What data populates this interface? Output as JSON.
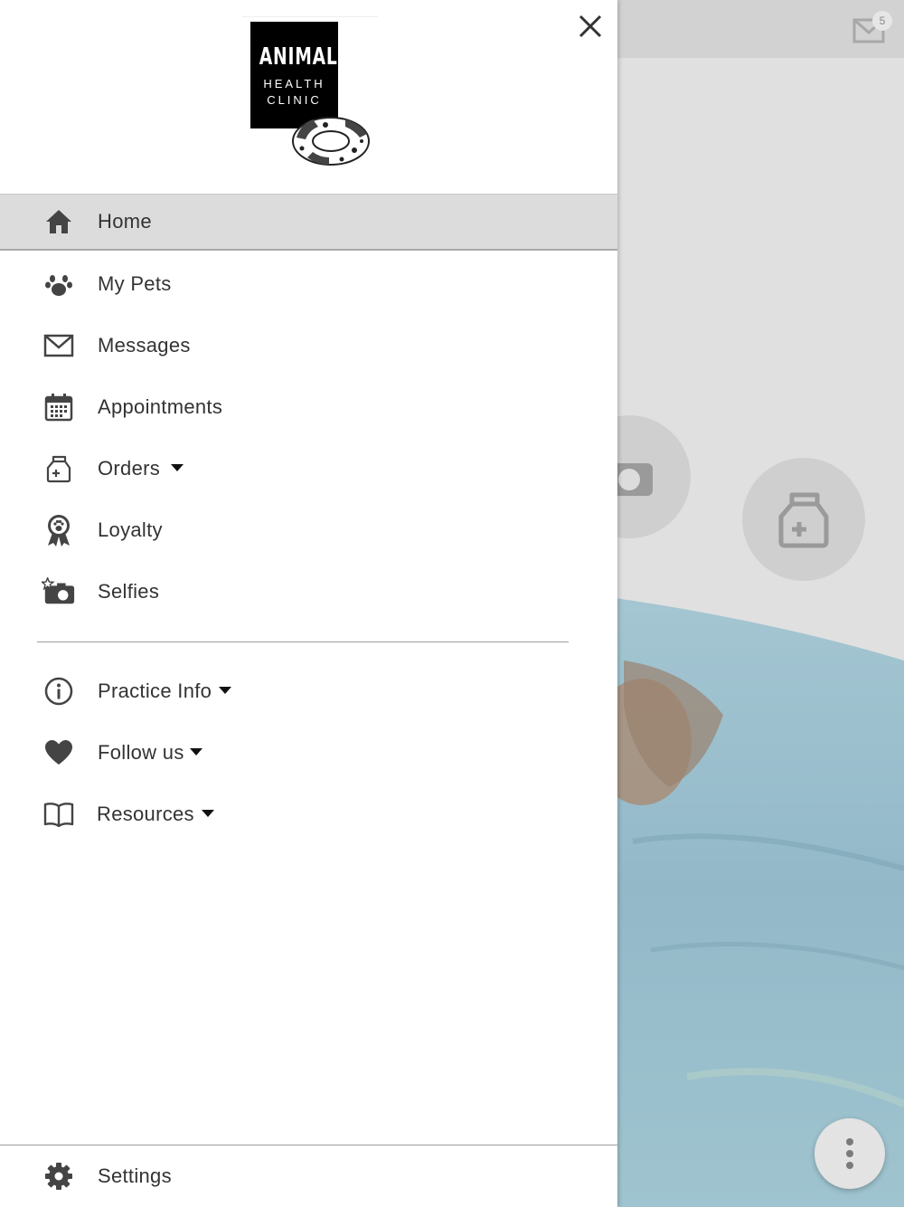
{
  "drawer": {
    "logo": {
      "line1": "ANIMAL",
      "line2": "HEALTH",
      "line3": "CLINIC"
    },
    "menu": [
      {
        "label": "Home",
        "icon": "home-icon",
        "active": true
      },
      {
        "label": "My Pets",
        "icon": "paw-icon"
      },
      {
        "label": "Messages",
        "icon": "envelope-icon"
      },
      {
        "label": "Appointments",
        "icon": "calendar-icon"
      },
      {
        "label": "Orders",
        "icon": "medicine-bag-icon",
        "has_dropdown": true
      },
      {
        "label": "Loyalty",
        "icon": "award-ribbon-icon"
      },
      {
        "label": "Selfies",
        "icon": "camera-star-icon"
      }
    ],
    "secondary_menu": [
      {
        "label": "Practice Info",
        "icon": "info-icon",
        "has_dropdown": true
      },
      {
        "label": "Follow us",
        "icon": "heart-icon",
        "has_dropdown": true
      },
      {
        "label": "Resources",
        "icon": "book-icon",
        "has_dropdown": true
      }
    ],
    "settings": {
      "label": "Settings",
      "icon": "gear-icon"
    }
  },
  "background": {
    "mail_badge_count": "5"
  },
  "colors": {
    "icon": "#444444",
    "text": "#333333",
    "active_bg": "#dcdcdc",
    "overlay_bg": "#e0e0e0"
  }
}
